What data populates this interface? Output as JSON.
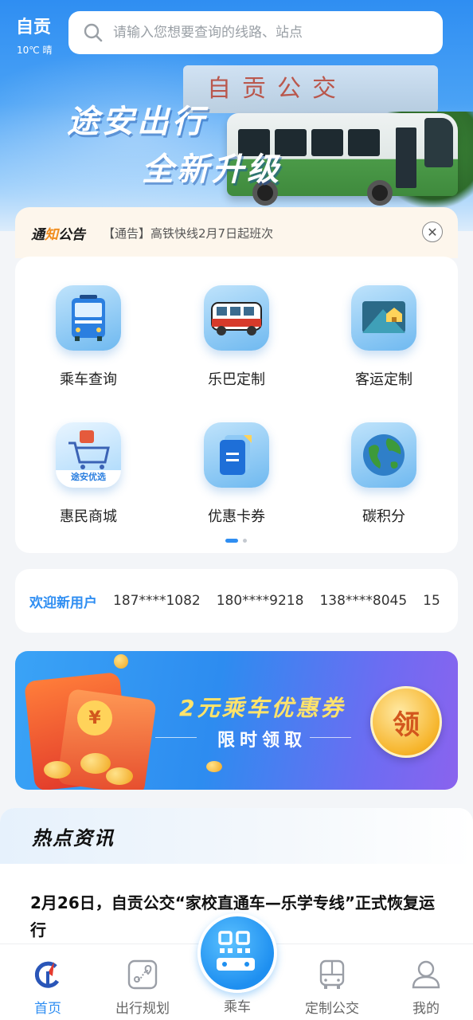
{
  "header": {
    "title": "自贡",
    "weather": "10℃ 晴",
    "search_placeholder": "请输入您想要查询的线路、站点"
  },
  "banner": {
    "slogan_line1": "途安出行",
    "slogan_line2": "全新升级",
    "gate_text": "自贡公交"
  },
  "notice": {
    "tag_part1": "通",
    "tag_highlight": "知",
    "tag_part2": "公告",
    "text": "【通告】高铁快线2月7日起班次",
    "close_icon": "close-icon"
  },
  "services": [
    {
      "label": "乘车查询",
      "icon": "city-bus-icon"
    },
    {
      "label": "乐巴定制",
      "icon": "minibus-icon"
    },
    {
      "label": "客运定制",
      "icon": "ticket-house-icon"
    },
    {
      "label": "惠民商城",
      "icon": "shopping-cart-icon",
      "badge": "途安优选"
    },
    {
      "label": "优惠卡券",
      "icon": "coupon-document-icon"
    },
    {
      "label": "碳积分",
      "icon": "globe-icon"
    }
  ],
  "pager": {
    "pages": 2,
    "current": 1
  },
  "welcome": {
    "label": "欢迎新用户",
    "users": [
      "187****1082",
      "180****9218",
      "138****8045",
      "15"
    ]
  },
  "coupon": {
    "title": "2元乘车优惠券",
    "subtitle": "限时领取",
    "claim_label": "领",
    "seal_glyph": "¥"
  },
  "news": {
    "section_title": "热点资讯",
    "headline": "2月26日，自贡公交“家校直通车—乐学专线”正式恢复运行"
  },
  "tabbar": {
    "items": [
      {
        "label": "首页",
        "icon": "home-logo-icon",
        "active": true
      },
      {
        "label": "出行规划",
        "icon": "route-map-icon",
        "active": false
      },
      {
        "label": "乘车",
        "icon": "qr-bus-icon",
        "active": false
      },
      {
        "label": "定制公交",
        "icon": "bus-outline-icon",
        "active": false
      },
      {
        "label": "我的",
        "icon": "user-icon",
        "active": false
      }
    ]
  },
  "colors": {
    "accent": "#2f8ef2",
    "notice_bg": "#fdf6ec",
    "coupon_title": "#ffe36b"
  }
}
